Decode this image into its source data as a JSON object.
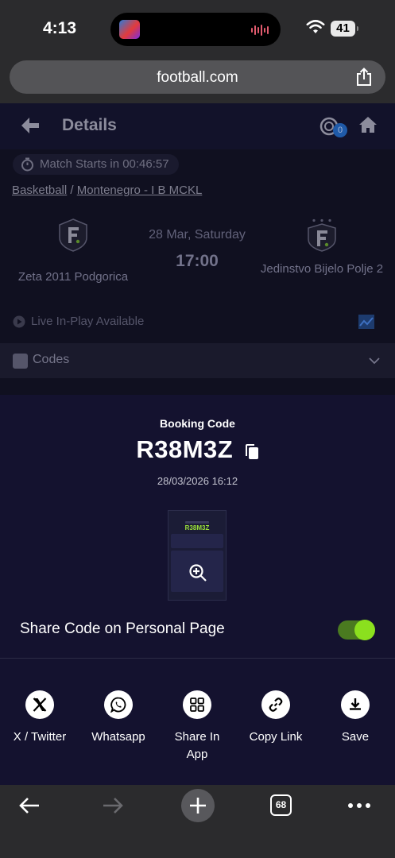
{
  "status_bar": {
    "time": "4:13",
    "battery": "41"
  },
  "browser": {
    "url": "football.com",
    "tab_count": "68"
  },
  "page": {
    "title": "Details",
    "coin_badge": "0",
    "match_timer": "Match Starts in 00:46:57",
    "breadcrumb": {
      "sport": "Basketball",
      "separator": "/",
      "league": "Montenegro - I B MCKL"
    },
    "home_team": "Zeta 2011 Podgorica",
    "away_team": "Jedinstvo Bijelo Polje 2",
    "match_date": "28 Mar, Saturday",
    "match_time": "17:00",
    "live_text": "Live In-Play Available",
    "codes_label": "Codes"
  },
  "sheet": {
    "booking_label": "Booking Code",
    "booking_code": "R38M3Z",
    "booking_date": "28/03/2026 16:12",
    "share_toggle_label": "Share Code on Personal Page",
    "share_toggle_on": true,
    "share_options": [
      {
        "label": "X / Twitter",
        "icon": "x-icon"
      },
      {
        "label": "Whatsapp",
        "icon": "whatsapp-icon"
      },
      {
        "label": "Share In App",
        "icon": "grid-icon"
      },
      {
        "label": "Copy Link",
        "icon": "link-icon"
      },
      {
        "label": "Save",
        "icon": "download-icon"
      }
    ]
  },
  "colors": {
    "accent": "#8be01e",
    "sheet_bg": "#14122f",
    "page_bg": "#101020"
  }
}
